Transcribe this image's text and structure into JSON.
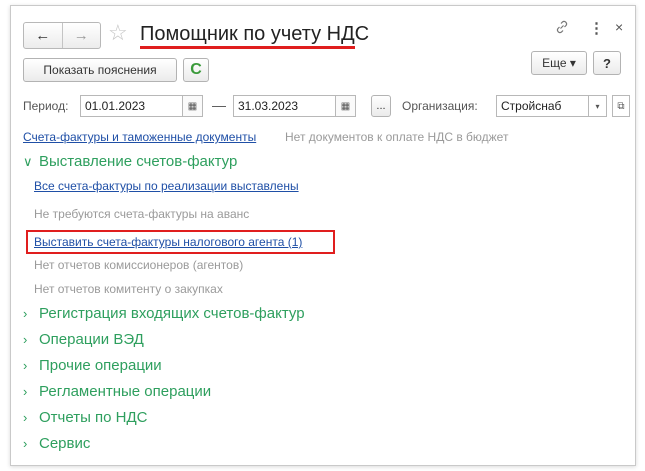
{
  "window": {
    "title": "Помощник по учету НДС",
    "nav_back": "←",
    "nav_forward": "→",
    "star": "☆",
    "link_icon": "🔗",
    "more_icon": "⋮",
    "close_icon": "×"
  },
  "toolbar": {
    "explain_label": "Показать пояснения",
    "refresh_glyph": "C",
    "more_label": "Еще ▾",
    "help_label": "?"
  },
  "filters": {
    "period_label": "Период:",
    "date_from": "01.01.2023",
    "dash": "—",
    "date_to": "31.03.2023",
    "ellipsis": "...",
    "org_label": "Организация:",
    "org_value": "Стройснаб"
  },
  "info": {
    "invoices_link": "Счета-фактуры и таможенные документы",
    "no_payment_docs": "Нет документов к оплате НДС в бюджет"
  },
  "sections": {
    "invoicing": {
      "title": "Выставление счетов-фактур",
      "expanded": true,
      "items": [
        {
          "text": "Все счета-фактуры по реализации выставлены",
          "type": "link"
        },
        {
          "text": "Не требуются счета-фактуры на аванс",
          "type": "muted"
        },
        {
          "text": "Выставить счета-фактуры налогового агента (1)",
          "type": "link"
        },
        {
          "text": "Нет отчетов комиссионеров (агентов)",
          "type": "muted"
        },
        {
          "text": "Нет отчетов комитенту о закупках",
          "type": "muted"
        }
      ]
    },
    "collapsed": [
      {
        "title": "Регистрация входящих счетов-фактур"
      },
      {
        "title": "Операции ВЭД"
      },
      {
        "title": "Прочие операции"
      },
      {
        "title": "Регламентные операции"
      },
      {
        "title": "Отчеты по НДС"
      },
      {
        "title": "Сервис"
      }
    ]
  },
  "colors": {
    "accent_green": "#2e9f5e",
    "link_blue": "#1f4fa6",
    "highlight_red": "#e01e1e"
  }
}
